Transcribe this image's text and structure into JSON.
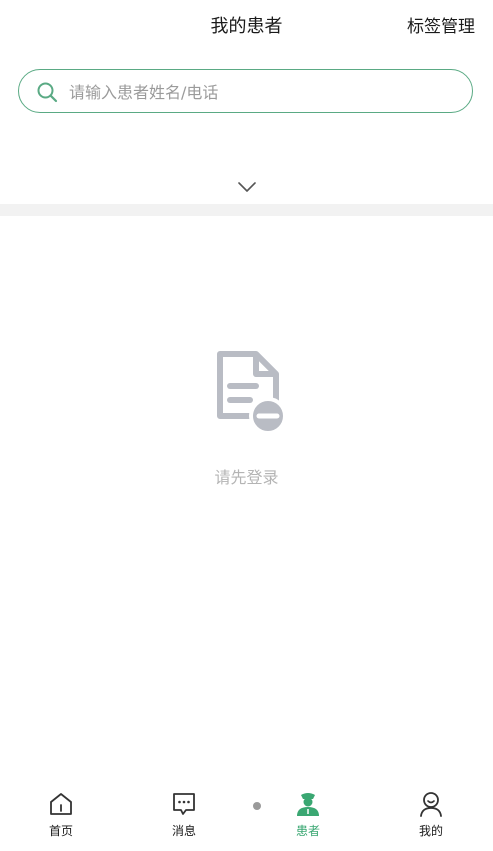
{
  "header": {
    "title": "我的患者",
    "tag_manage": "标签管理"
  },
  "search": {
    "placeholder": "请输入患者姓名/电话",
    "value": ""
  },
  "empty_state": {
    "message": "请先登录",
    "icon": "document-remove-icon"
  },
  "tabbar": {
    "items": [
      {
        "label": "首页",
        "icon": "home-icon",
        "active": false
      },
      {
        "label": "消息",
        "icon": "message-icon",
        "active": false
      },
      {
        "label": "患者",
        "icon": "doctor-icon",
        "active": true
      },
      {
        "label": "我的",
        "icon": "user-icon",
        "active": false
      }
    ]
  },
  "colors": {
    "accent": "#3aa772",
    "search_border": "#5aaa84",
    "muted_text": "#b4b4b4",
    "divider": "#f2f2f2"
  }
}
